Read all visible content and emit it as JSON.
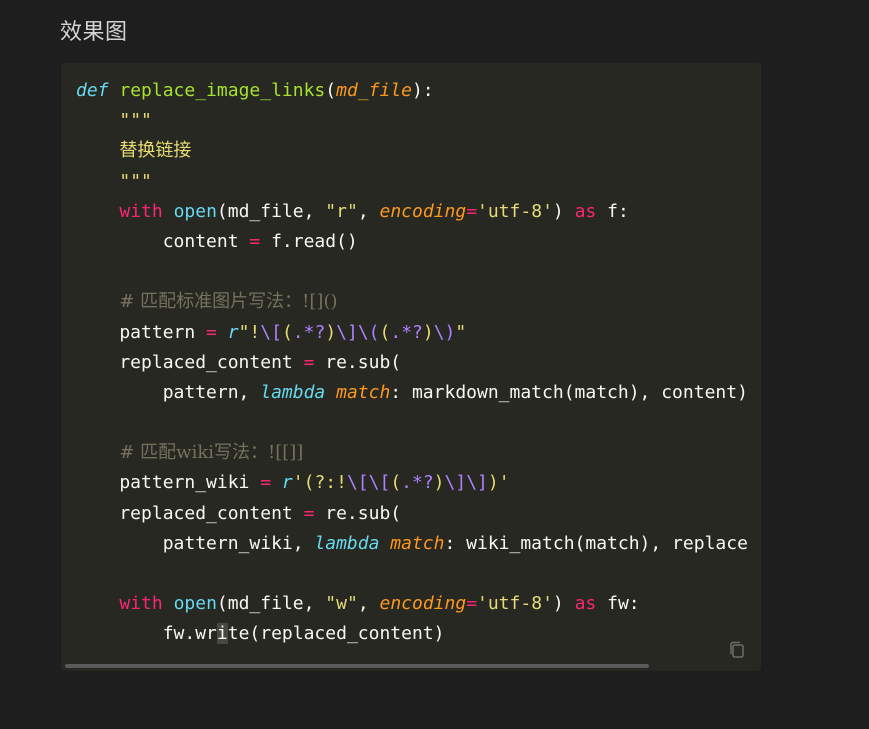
{
  "page": {
    "heading": "效果图"
  },
  "code": {
    "language": "python",
    "lines": [
      [
        {
          "t": "def",
          "c": "def"
        },
        {
          "t": " "
        },
        {
          "t": "replace_image_links",
          "c": "fn"
        },
        {
          "t": "("
        },
        {
          "t": "md_file",
          "c": "param"
        },
        {
          "t": "):"
        }
      ],
      [
        {
          "t": "    "
        },
        {
          "t": "\"\"\"",
          "c": "str"
        }
      ],
      [
        {
          "t": "    "
        },
        {
          "t": "替换链接",
          "c": "str"
        }
      ],
      [
        {
          "t": "    "
        },
        {
          "t": "\"\"\"",
          "c": "str"
        }
      ],
      [
        {
          "t": "    "
        },
        {
          "t": "with",
          "c": "kw"
        },
        {
          "t": " "
        },
        {
          "t": "open",
          "c": "builtin"
        },
        {
          "t": "(md_file, "
        },
        {
          "t": "\"r\"",
          "c": "str"
        },
        {
          "t": ", "
        },
        {
          "t": "encoding",
          "c": "param"
        },
        {
          "t": "=",
          "c": "op"
        },
        {
          "t": "'utf-8'",
          "c": "str"
        },
        {
          "t": ") "
        },
        {
          "t": "as",
          "c": "kw"
        },
        {
          "t": " f:"
        }
      ],
      [
        {
          "t": "        content "
        },
        {
          "t": "=",
          "c": "op"
        },
        {
          "t": " f.read()"
        }
      ],
      [
        {
          "t": ""
        }
      ],
      [
        {
          "t": "    "
        },
        {
          "t": "# 匹配标准图片写法：![]()",
          "c": "cmt"
        }
      ],
      [
        {
          "t": "    pattern "
        },
        {
          "t": "=",
          "c": "op"
        },
        {
          "t": " "
        },
        {
          "t": "r",
          "c": "lam"
        },
        {
          "t": "\"!",
          "c": "str"
        },
        {
          "t": "\\[",
          "c": "rx"
        },
        {
          "t": "(",
          "c": "str"
        },
        {
          "t": ".*?",
          "c": "rx"
        },
        {
          "t": ")",
          "c": "str"
        },
        {
          "t": "\\]\\(",
          "c": "rx"
        },
        {
          "t": "(",
          "c": "str"
        },
        {
          "t": ".*?",
          "c": "rx"
        },
        {
          "t": ")",
          "c": "str"
        },
        {
          "t": "\\)",
          "c": "rx"
        },
        {
          "t": "\"",
          "c": "str"
        }
      ],
      [
        {
          "t": "    replaced_content "
        },
        {
          "t": "=",
          "c": "op"
        },
        {
          "t": " re.sub("
        }
      ],
      [
        {
          "t": "        pattern, "
        },
        {
          "t": "lambda",
          "c": "lam"
        },
        {
          "t": " "
        },
        {
          "t": "match",
          "c": "param"
        },
        {
          "t": ": markdown_match(match), content)"
        }
      ],
      [
        {
          "t": ""
        }
      ],
      [
        {
          "t": "    "
        },
        {
          "t": "# 匹配wiki写法：![[]]",
          "c": "cmt"
        }
      ],
      [
        {
          "t": "    pattern_wiki "
        },
        {
          "t": "=",
          "c": "op"
        },
        {
          "t": " "
        },
        {
          "t": "r",
          "c": "lam"
        },
        {
          "t": "'(?:!",
          "c": "str"
        },
        {
          "t": "\\[\\[",
          "c": "rx"
        },
        {
          "t": "(",
          "c": "str"
        },
        {
          "t": ".*?",
          "c": "rx"
        },
        {
          "t": ")",
          "c": "str"
        },
        {
          "t": "\\]\\]",
          "c": "rx"
        },
        {
          "t": ")'",
          "c": "str"
        }
      ],
      [
        {
          "t": "    replaced_content "
        },
        {
          "t": "=",
          "c": "op"
        },
        {
          "t": " re.sub("
        }
      ],
      [
        {
          "t": "        pattern_wiki, "
        },
        {
          "t": "lambda",
          "c": "lam"
        },
        {
          "t": " "
        },
        {
          "t": "match",
          "c": "param"
        },
        {
          "t": ": wiki_match(match), replace"
        }
      ],
      [
        {
          "t": ""
        }
      ],
      [
        {
          "t": "    "
        },
        {
          "t": "with",
          "c": "kw"
        },
        {
          "t": " "
        },
        {
          "t": "open",
          "c": "builtin"
        },
        {
          "t": "(md_file, "
        },
        {
          "t": "\"w\"",
          "c": "str"
        },
        {
          "t": ", "
        },
        {
          "t": "encoding",
          "c": "param"
        },
        {
          "t": "=",
          "c": "op"
        },
        {
          "t": "'utf-8'",
          "c": "str"
        },
        {
          "t": ") "
        },
        {
          "t": "as",
          "c": "kw"
        },
        {
          "t": " fw:"
        }
      ],
      [
        {
          "t": "        fw.wr"
        },
        {
          "t": "i",
          "c": "cursor-hl"
        },
        {
          "t": "te(replaced_content)"
        }
      ]
    ]
  },
  "toolbar": {
    "copy_icon": "copy-icon"
  },
  "colors": {
    "background": "#1e1e1e",
    "code_background": "#272822",
    "keyword": "#f92672",
    "function": "#a6e22e",
    "string": "#e6db74",
    "builtin": "#66d9ef",
    "param": "#fd971f",
    "comment": "#75715e",
    "regex": "#ae81ff"
  }
}
